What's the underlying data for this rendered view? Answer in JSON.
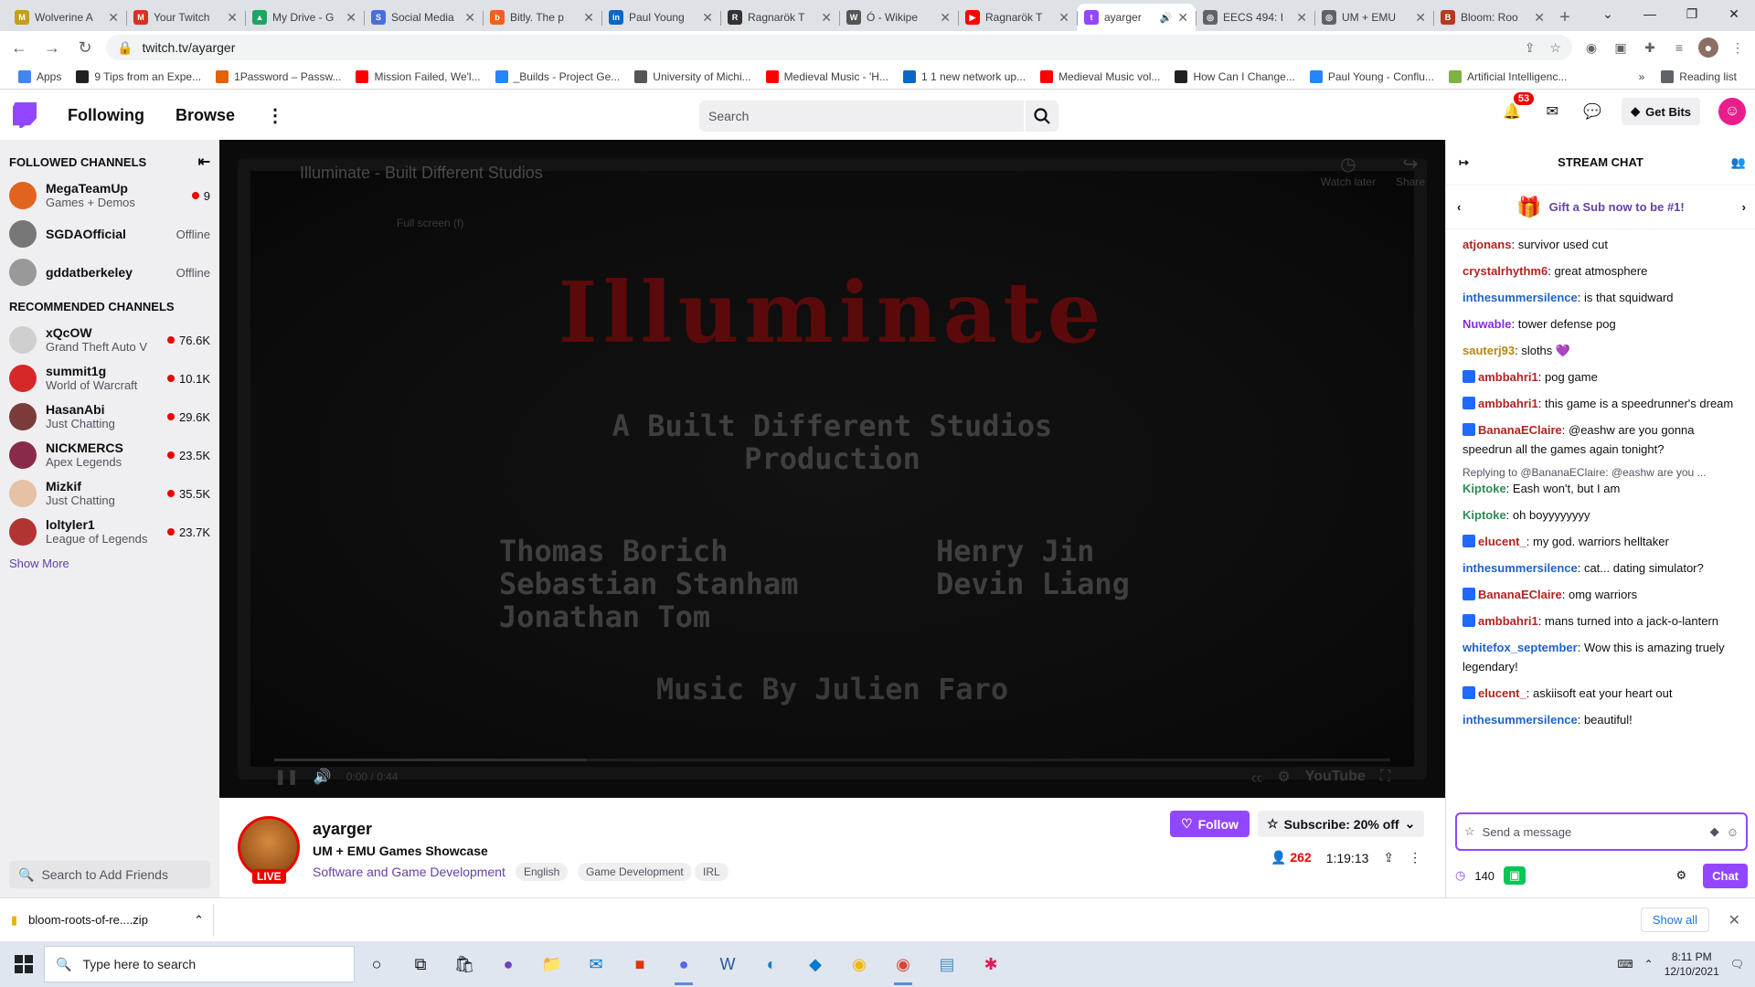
{
  "browser": {
    "tabs": [
      {
        "title": "Wolverine A",
        "color": "#c59d1a",
        "glyph": "M"
      },
      {
        "title": "Your Twitch",
        "color": "#d93025",
        "glyph": "M"
      },
      {
        "title": "My Drive - G",
        "color": "#1fa463",
        "glyph": "▲"
      },
      {
        "title": "Social Media",
        "color": "#4a6ee0",
        "glyph": "S"
      },
      {
        "title": "Bitly. The p",
        "color": "#ee6123",
        "glyph": "b"
      },
      {
        "title": "Paul Young",
        "color": "#0a66c2",
        "glyph": "in"
      },
      {
        "title": "Ragnarök T",
        "color": "#333333",
        "glyph": "R"
      },
      {
        "title": "Ó - Wikipe",
        "color": "#555555",
        "glyph": "W"
      },
      {
        "title": "Ragnarök T",
        "color": "#ff0000",
        "glyph": "▶"
      },
      {
        "title": "ayarger",
        "color": "#9147ff",
        "glyph": "t",
        "active": true
      },
      {
        "title": "EECS 494: I",
        "color": "#5f6368",
        "glyph": "◎"
      },
      {
        "title": "UM + EMU",
        "color": "#5f6368",
        "glyph": "◎"
      },
      {
        "title": "Bloom: Roo",
        "color": "#b43c1e",
        "glyph": "B"
      }
    ],
    "url": "twitch.tv/ayarger",
    "bookmarks": [
      {
        "label": "Apps",
        "color": "#4285f4"
      },
      {
        "label": "9 Tips from an Expe...",
        "color": "#202124"
      },
      {
        "label": "1Password – Passw...",
        "color": "#e36209"
      },
      {
        "label": "Mission Failed, We'l...",
        "color": "#ff0000"
      },
      {
        "label": "_Builds - Project Ge...",
        "color": "#2684ff"
      },
      {
        "label": "University of Michi...",
        "color": "#555555"
      },
      {
        "label": "Medieval Music - 'H...",
        "color": "#ff0000"
      },
      {
        "label": "1 1 new network up...",
        "color": "#0a66c2"
      },
      {
        "label": "Medieval Music vol...",
        "color": "#ff0000"
      },
      {
        "label": "How Can I Change...",
        "color": "#202124"
      },
      {
        "label": "Paul Young - Conflu...",
        "color": "#2684ff"
      },
      {
        "label": "Artificial Intelligenc...",
        "color": "#7cb342"
      }
    ],
    "reading_list": "Reading list"
  },
  "topnav": {
    "following": "Following",
    "browse": "Browse",
    "search_placeholder": "Search",
    "notif_count": "53",
    "get_bits": "Get Bits"
  },
  "sidebar": {
    "followed_header": "FOLLOWED CHANNELS",
    "followed": [
      {
        "name": "MegaTeamUp",
        "game": "Games + Demos",
        "status": "9",
        "live": true,
        "color": "#e0641e"
      },
      {
        "name": "SGDAOfficial",
        "game": "",
        "status": "Offline",
        "live": false,
        "color": "#777777"
      },
      {
        "name": "gddatberkeley",
        "game": "",
        "status": "Offline",
        "live": false,
        "color": "#999999"
      }
    ],
    "recommended_header": "RECOMMENDED CHANNELS",
    "recommended": [
      {
        "name": "xQcOW",
        "game": "Grand Theft Auto V",
        "status": "76.6K",
        "color": "#cfcfcf"
      },
      {
        "name": "summit1g",
        "game": "World of Warcraft",
        "status": "10.1K",
        "color": "#d62828"
      },
      {
        "name": "HasanAbi",
        "game": "Just Chatting",
        "status": "29.6K",
        "color": "#7a3b3b"
      },
      {
        "name": "NICKMERCS",
        "game": "Apex Legends",
        "status": "23.5K",
        "color": "#8a2a4a"
      },
      {
        "name": "Mizkif",
        "game": "Just Chatting",
        "status": "35.5K",
        "color": "#e6c1a4"
      },
      {
        "name": "loltyler1",
        "game": "League of Legends",
        "status": "23.7K",
        "color": "#b33232"
      }
    ],
    "show_more": "Show More",
    "search_friends": "Search to Add Friends"
  },
  "player": {
    "video_title": "Illuminate - Built Different Studios",
    "watch_later": "Watch later",
    "share": "Share",
    "fullscreen_hint": "Full screen (f)",
    "game_title": "Illuminate",
    "production_line1": "A Built Different Studios",
    "production_line2": "Production",
    "credits_left": [
      "Thomas Borich",
      "Sebastian Stanham",
      "Jonathan Tom"
    ],
    "credits_right": [
      "Henry Jin",
      "Devin Liang"
    ],
    "music": "Music By Julien Faro",
    "time": "0:00 / 0:44",
    "progress": 0.28,
    "youtube": "YouTube"
  },
  "stream": {
    "channel": "ayarger",
    "live": "LIVE",
    "title": "UM + EMU Games Showcase",
    "category": "Software and Game Development",
    "tags": [
      "English",
      "Game Development",
      "IRL"
    ],
    "follow": "Follow",
    "subscribe": "Subscribe: 20% off",
    "viewers": "262",
    "uptime": "1:19:13"
  },
  "chat": {
    "header": "STREAM CHAT",
    "gift": "Gift a Sub now to be #1!",
    "messages": [
      {
        "user": "atjonans",
        "color": "#b22222",
        "text": "survivor used cut",
        "badge": false
      },
      {
        "user": "crystalrhythm6",
        "color": "#b22222",
        "text": "great atmosphere",
        "badge": false
      },
      {
        "user": "inthesummersilence",
        "color": "#1e62c8",
        "text": "is that squidward",
        "badge": false
      },
      {
        "user": "Nuwable",
        "color": "#8a2be2",
        "text": "tower defense pog",
        "badge": false
      },
      {
        "user": "sauterj93",
        "color": "#b8860b",
        "text": "sloths 💜",
        "badge": false
      },
      {
        "user": "ambbahri1",
        "color": "#b22222",
        "text": "pog game",
        "badge": true
      },
      {
        "user": "ambbahri1",
        "color": "#b22222",
        "text": "this game is a speedrunner's dream",
        "badge": true
      },
      {
        "user": "BananaEClaire",
        "color": "#b22222",
        "text": "@eashw are you gonna speedrun all the games again tonight?",
        "badge": true
      },
      {
        "reply": "Replying to @BananaEClaire: @eashw are you ...",
        "user": "Kiptoke",
        "color": "#2e8b57",
        "text": "Eash won't, but I am",
        "badge": false
      },
      {
        "user": "Kiptoke",
        "color": "#2e8b57",
        "text": "oh boyyyyyyyy",
        "badge": false
      },
      {
        "user": "elucent_",
        "color": "#b22222",
        "text": "my god. warriors helltaker",
        "badge": true
      },
      {
        "user": "inthesummersilence",
        "color": "#1e62c8",
        "text": "cat... dating simulator?",
        "badge": false
      },
      {
        "user": "BananaEClaire",
        "color": "#b22222",
        "text": "omg warriors",
        "badge": true
      },
      {
        "user": "ambbahri1",
        "color": "#b22222",
        "text": "mans turned into a jack-o-lantern",
        "badge": true
      },
      {
        "user": "whitefox_september",
        "color": "#1e62c8",
        "text": "Wow this is amazing truely legendary!",
        "badge": false
      },
      {
        "user": "elucent_",
        "color": "#b22222",
        "text": "askiisoft eat your heart out",
        "badge": true
      },
      {
        "user": "inthesummersilence",
        "color": "#1e62c8",
        "text": "beautiful!",
        "badge": false
      }
    ],
    "input_placeholder": "Send a message",
    "points": "140",
    "chat_button": "Chat"
  },
  "downloads": {
    "file": "bloom-roots-of-re....zip",
    "show_all": "Show all"
  },
  "taskbar": {
    "search_placeholder": "Type here to search",
    "time": "8:11 PM",
    "date": "12/10/2021"
  }
}
